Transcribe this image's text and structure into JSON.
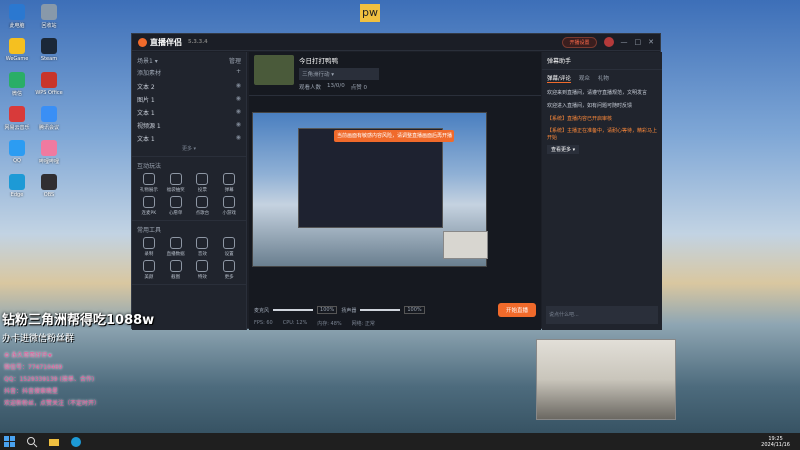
{
  "desktop": {
    "icons": [
      {
        "label": "此电脑",
        "color": "#2b78d0"
      },
      {
        "label": "WeGame",
        "color": "#f5c020"
      },
      {
        "label": "微信",
        "color": "#2aae67"
      },
      {
        "label": "网易云音乐",
        "color": "#d83a3a"
      },
      {
        "label": "QQ",
        "color": "#2c9cf2"
      },
      {
        "label": "Edge",
        "color": "#1d9ad6"
      },
      {
        "label": "回收站",
        "color": "#8899aa"
      },
      {
        "label": "Steam",
        "color": "#1b2838"
      },
      {
        "label": "WPS Office",
        "color": "#c8352b"
      },
      {
        "label": "腾讯会议",
        "color": "#3a8ff5"
      },
      {
        "label": "哔哩哔哩",
        "color": "#f07aa0"
      },
      {
        "label": "OBS",
        "color": "#302e31"
      }
    ],
    "badge": "pw"
  },
  "app": {
    "name": "直播伴侣",
    "version": "5.3.3.4",
    "live_button": "开播设置",
    "window_controls": [
      "—",
      "□",
      "✕"
    ]
  },
  "scenes": {
    "header": "场景1 ▾",
    "manage": "管理",
    "add": "+",
    "group_label": "添加素材",
    "items": [
      "文本 2",
      "图片 1",
      "文本 1",
      "视频源 1",
      "文本 1"
    ],
    "more": "更多 ▾"
  },
  "tools_1": {
    "header": "互动玩法",
    "items": [
      "礼物展示",
      "福袋抽奖",
      "投票",
      "弹幕",
      "连麦PK",
      "心愿单",
      "点歌台",
      "小游戏"
    ]
  },
  "tools_2": {
    "header": "常用工具",
    "items": [
      "录制",
      "直播数据",
      "音效",
      "设置",
      "美颜",
      "截图",
      "特效",
      "更多"
    ]
  },
  "stream": {
    "title": "今日打打鸭鸭",
    "category": "三角洲行动 ▾",
    "stats": [
      "观看人数",
      "13/0/0",
      "点赞 0"
    ],
    "notice": "当前画面有敏感内容风险，请调整直播画面后再开播",
    "mic_label": "麦克风",
    "mic_pct": "100%",
    "speaker_label": "扬声器",
    "speaker_pct": "100%",
    "start_button": "开始直播",
    "status": [
      "FPS: 60",
      "CPU: 12%",
      "内存: 48%",
      "网络: 正常"
    ]
  },
  "chat": {
    "title": "弹幕助手",
    "tabs": [
      "弹幕/评论",
      "观众",
      "礼物"
    ],
    "messages": [
      {
        "text": "欢迎来到直播间，请遵守直播规范，文明发言",
        "hl": false
      },
      {
        "text": "欢迎进入直播间，如有问题可随时反馈",
        "hl": false
      },
      {
        "text": "【系统】直播内容已开启审核",
        "hl": true
      },
      {
        "text": "【系统】主播正在准备中，请耐心等待，精彩马上开始",
        "hl": true
      }
    ],
    "more": "查看更多 ▾",
    "input_placeholder": "说点什么吧..."
  },
  "overlay": {
    "title": "钻粉三角洲帮得吃1088w",
    "sub": "办卡进微信粉丝群",
    "lines": [
      "⚙ 永久哥哥好评★",
      "微信号：774710469",
      "QQ：1529339139 (接单、合作)",
      "抖音：抖音搜索晚星",
      "欢迎新粉丝，点赞关注（不定时开）"
    ]
  },
  "taskbar": {
    "time": "19:25",
    "date": "2024/11/16"
  }
}
